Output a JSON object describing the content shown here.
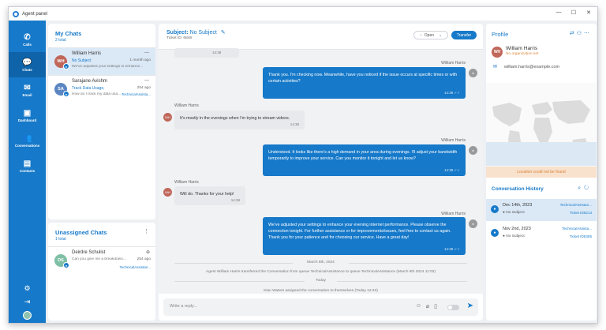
{
  "window": {
    "title": "Agent panel",
    "controls": [
      "—",
      "☐",
      "✕"
    ]
  },
  "nav": {
    "items": [
      {
        "label": "Calls",
        "icon": "phone-icon"
      },
      {
        "label": "Chats",
        "icon": "chat-icon"
      },
      {
        "label": "Email",
        "icon": "email-icon"
      },
      {
        "label": "Dashboard",
        "icon": "dashboard-icon"
      },
      {
        "label": "Conversations",
        "icon": "people-icon"
      },
      {
        "label": "Contacts",
        "icon": "contacts-icon"
      }
    ]
  },
  "my_chats": {
    "title": "My Chats",
    "total": "2 total",
    "rows": [
      {
        "initials": "WH",
        "name": "William Harris",
        "subject": "No Subject",
        "preview": "We've adjusted your settings to enhance...",
        "time": "1 month ago",
        "tag": "",
        "dash": "—",
        "color": "#c0675a"
      },
      {
        "initials": "SA",
        "name": "Sarajane Avishm",
        "subject": "Track Data Usage,",
        "preview": "How do I track my data usa...",
        "time": "254 ago",
        "tag": "TechnicalAssista...",
        "dash": "—",
        "color": "#5b86c2"
      }
    ]
  },
  "unassigned": {
    "title": "Unassigned Chats",
    "total": "1 total",
    "rows": [
      {
        "initials": "DS",
        "name": "Deirdre Schulist",
        "preview": "Can you give me a breakdown...",
        "time": "254 ago",
        "tag": "TechnicalAssistan...",
        "color": "#7fbfa6"
      }
    ]
  },
  "conversation": {
    "subject_label": "Subject:",
    "subject_value": "No Subject",
    "ticket": "Ticket ID: 6848",
    "status": "Open",
    "transfer_label": "Transfer",
    "top_time": "14:38",
    "messages": [
      {
        "from": "William Harris",
        "text": "Thank you. I'm checking now. Meanwhile, have you noticed if the issue occurs at specific times or with certain activities?",
        "time": "14:38 ✓✓"
      },
      {
        "from": "William Harris",
        "text": "It's mostly in the evenings when I'm trying to stream videos.",
        "time": "14:38"
      },
      {
        "from": "William Harris",
        "text": "Understood. It looks like there's a high demand in your area during evenings. I'll adjust your bandwidth temporarily to improve your service. Can you monitor it tonight and let us know?",
        "time": "14:38 ✓✓"
      },
      {
        "from": "William Harris",
        "text": "Will do. Thanks for your help!",
        "time": "14:38"
      },
      {
        "from": "William Harris",
        "text": "We've adjusted your settings to enhance your evening internet performance. Please observe the connection tonight. For further assistance or for improvements/issues, feel free to contact us again. Thank you for your patience and for choosing our service. Have a great day!",
        "time": "14:38 ✓✓"
      }
    ],
    "date_1": "March 8th, 2024",
    "system_1": "Agent William Harris transferred the Conversation from queue TechnicalAssistance to queue TechnicalAssistance (March 8th 2024 11:03)",
    "date_2": "Today",
    "system_2": "Kian Waters assigned the conversation to themselves (Today 12:43)",
    "composer_placeholder": "Write a reply..."
  },
  "profile": {
    "title": "Profile",
    "initials": "WH",
    "name": "William Harris",
    "organization": "No organization set",
    "email": "william.harris@example.com",
    "location_msg": "Location could not be found"
  },
  "history": {
    "title": "Conversation History",
    "rows": [
      {
        "date": "Dec 14th, 2023",
        "subject": "No Subject",
        "queue": "TechnicalAssistan...",
        "ticket": "Ticket ID6213"
      },
      {
        "date": "Nov 2nd, 2023",
        "subject": "No Subject",
        "queue": "TechnicalAssista...",
        "ticket": "Ticket ID5305"
      }
    ]
  },
  "colors": {
    "primary": "#1679c9",
    "nav_active": "#0f64a9",
    "warning": "#e08a3a"
  }
}
